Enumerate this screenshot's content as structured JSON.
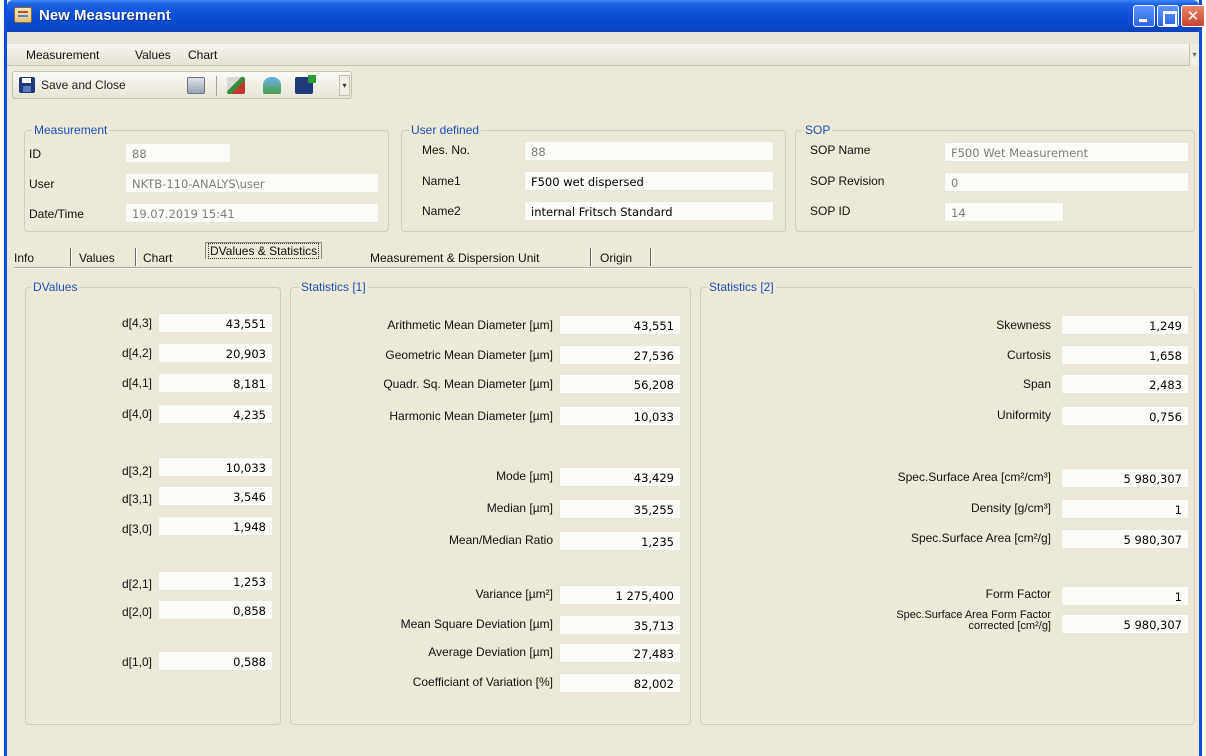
{
  "window": {
    "title": "New Measurement"
  },
  "menu": [
    "Measurement",
    "Values",
    "Chart"
  ],
  "toolbar": {
    "save_close_label": "Save and Close"
  },
  "measurement_group": {
    "legend": "Measurement",
    "id_label": "ID",
    "id_value": "88",
    "user_label": "User",
    "user_value": "NKTB-110-ANALYS\\user",
    "datetime_label": "Date/Time",
    "datetime_value": "19.07.2019 15:41"
  },
  "user_defined_group": {
    "legend": "User defined",
    "mesno_label": "Mes. No.",
    "mesno_value": "88",
    "name1_label": "Name1",
    "name1_value": "F500 wet dispersed",
    "name2_label": "Name2",
    "name2_value": "internal Fritsch Standard"
  },
  "sop_group": {
    "legend": "SOP",
    "name_label": "SOP Name",
    "name_value": "F500 Wet Measurement",
    "revision_label": "SOP Revision",
    "revision_value": "0",
    "id_label": "SOP ID",
    "id_value": "14"
  },
  "tabs": [
    "Info",
    "Values",
    "Chart",
    "DValues & Statistics",
    "Measurement & Dispersion Unit",
    "Origin"
  ],
  "active_tab": "DValues & Statistics",
  "dvalues": {
    "legend": "DValues",
    "rows": [
      {
        "label": "d[4,3]",
        "value": "43,551"
      },
      {
        "label": "d[4,2]",
        "value": "20,903"
      },
      {
        "label": "d[4,1]",
        "value": "8,181"
      },
      {
        "label": "d[4,0]",
        "value": "4,235"
      },
      {
        "label": "d[3,2]",
        "value": "10,033"
      },
      {
        "label": "d[3,1]",
        "value": "3,546"
      },
      {
        "label": "d[3,0]",
        "value": "1,948"
      },
      {
        "label": "d[2,1]",
        "value": "1,253"
      },
      {
        "label": "d[2,0]",
        "value": "0,858"
      },
      {
        "label": "d[1,0]",
        "value": "0,588"
      }
    ]
  },
  "statistics1": {
    "legend": "Statistics [1]",
    "rows": [
      {
        "label": "Arithmetic Mean Diameter [µm]",
        "value": "43,551"
      },
      {
        "label": "Geometric Mean Diameter [µm]",
        "value": "27,536"
      },
      {
        "label": "Quadr. Sq. Mean Diameter [µm]",
        "value": "56,208"
      },
      {
        "label": "Harmonic Mean Diameter [µm]",
        "value": "10,033"
      },
      {
        "label": "Mode [µm]",
        "value": "43,429"
      },
      {
        "label": "Median [µm]",
        "value": "35,255"
      },
      {
        "label": "Mean/Median Ratio",
        "value": "1,235"
      },
      {
        "label": "Variance [µm²]",
        "value": "1 275,400"
      },
      {
        "label": "Mean Square Deviation [µm]",
        "value": "35,713"
      },
      {
        "label": "Average Deviation [µm]",
        "value": "27,483"
      },
      {
        "label": "Coefficiant of Variation [%]",
        "value": "82,002"
      }
    ]
  },
  "statistics2": {
    "legend": "Statistics [2]",
    "rows": [
      {
        "label": "Skewness",
        "value": "1,249"
      },
      {
        "label": "Curtosis",
        "value": "1,658"
      },
      {
        "label": "Span",
        "value": "2,483"
      },
      {
        "label": "Uniformity",
        "value": "0,756"
      },
      {
        "label": "Spec.Surface Area [cm²/cm³]",
        "value": "5 980,307"
      },
      {
        "label": "Density [g/cm³]",
        "value": "1"
      },
      {
        "label": "Spec.Surface Area [cm²/g]",
        "value": "5 980,307"
      },
      {
        "label": "Form Factor",
        "value": "1"
      },
      {
        "label": "Spec.Surface Area Form Factor corrected [cm²/g]",
        "value": "5 980,307"
      }
    ]
  }
}
